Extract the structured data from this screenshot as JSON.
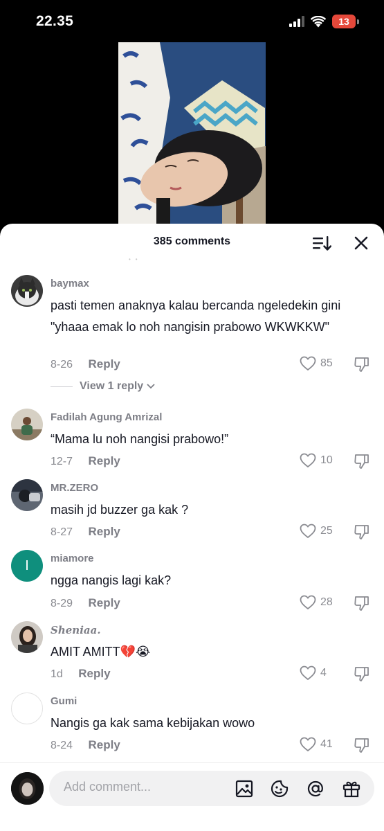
{
  "status_bar": {
    "time": "22.35",
    "battery": "13"
  },
  "sheet": {
    "title": "385 comments"
  },
  "comments": [
    {
      "username": "baymax",
      "text": "pasti temen anaknya kalau bercanda ngeledekin gini \"yhaaa emak lo noh nangisin prabowo WKWKKW\"",
      "date": "8-26",
      "reply_label": "Reply",
      "likes": "85",
      "view_replies": "View 1 reply"
    },
    {
      "username": "Fadilah Agung Amrizal",
      "text": "“Mama lu noh nangisi prabowo!”",
      "date": "12-7",
      "reply_label": "Reply",
      "likes": "10"
    },
    {
      "username": "MR.ZERO",
      "text": "masih jd buzzer ga kak ?",
      "date": "8-27",
      "reply_label": "Reply",
      "likes": "25"
    },
    {
      "username": "miamore",
      "avatar_letter": "I",
      "text": "ngga nangis lagi kak?",
      "date": "8-29",
      "reply_label": "Reply",
      "likes": "28"
    },
    {
      "username": "Sheniaa.",
      "text": "AMIT AMITT💔😭",
      "date": "1d",
      "reply_label": "Reply",
      "likes": "4"
    },
    {
      "username": "Gumi",
      "text": "Nangis ga kak sama kebijakan wowo",
      "date": "8-24",
      "reply_label": "Reply",
      "likes": "41"
    }
  ],
  "input": {
    "placeholder": "Add comment..."
  },
  "colors": {
    "sheet_bg": "#ffffff",
    "text_primary": "#161823",
    "text_secondary": "#7d7e86",
    "battery_low": "#e5483a",
    "avatar_teal": "#0f8f7d"
  }
}
